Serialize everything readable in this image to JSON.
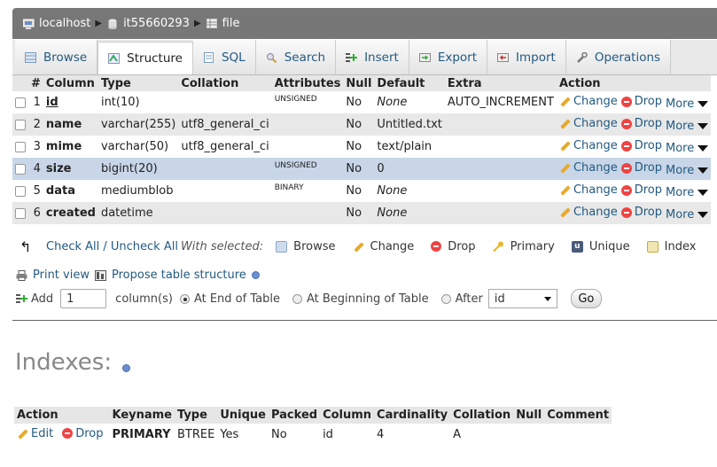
{
  "breadcrumb": {
    "server": "localhost",
    "database": "it55660293",
    "table": "file"
  },
  "tabs": [
    {
      "label": "Browse",
      "icon": "table-icon"
    },
    {
      "label": "Structure",
      "icon": "structure-icon",
      "active": true
    },
    {
      "label": "SQL",
      "icon": "sql-icon"
    },
    {
      "label": "Search",
      "icon": "search-icon"
    },
    {
      "label": "Insert",
      "icon": "insert-icon"
    },
    {
      "label": "Export",
      "icon": "export-icon"
    },
    {
      "label": "Import",
      "icon": "import-icon"
    },
    {
      "label": "Operations",
      "icon": "wrench-icon"
    }
  ],
  "structure": {
    "headers": {
      "num": "#",
      "column": "Column",
      "type": "Type",
      "collation": "Collation",
      "attributes": "Attributes",
      "null": "Null",
      "default": "Default",
      "extra": "Extra",
      "action": "Action"
    },
    "rows": [
      {
        "num": "1",
        "column": "id",
        "type": "int(10)",
        "collation": "",
        "attributes": "UNSIGNED",
        "null": "No",
        "default": "None",
        "extra": "AUTO_INCREMENT"
      },
      {
        "num": "2",
        "column": "name",
        "type": "varchar(255)",
        "collation": "utf8_general_ci",
        "attributes": "",
        "null": "No",
        "default": "Untitled.txt",
        "extra": ""
      },
      {
        "num": "3",
        "column": "mime",
        "type": "varchar(50)",
        "collation": "utf8_general_ci",
        "attributes": "",
        "null": "No",
        "default": "text/plain",
        "extra": ""
      },
      {
        "num": "4",
        "column": "size",
        "type": "bigint(20)",
        "collation": "",
        "attributes": "UNSIGNED",
        "null": "No",
        "default": "0",
        "extra": ""
      },
      {
        "num": "5",
        "column": "data",
        "type": "mediumblob",
        "collation": "",
        "attributes": "BINARY",
        "null": "No",
        "default": "None",
        "extra": ""
      },
      {
        "num": "6",
        "column": "created",
        "type": "datetime",
        "collation": "",
        "attributes": "",
        "null": "No",
        "default": "None",
        "extra": ""
      }
    ],
    "actions": {
      "change": "Change",
      "drop": "Drop",
      "more": "More"
    }
  },
  "with_selected": {
    "check_all": "Check All / Uncheck All",
    "with_selected": "With selected:",
    "buttons": [
      "Browse",
      "Change",
      "Drop",
      "Primary",
      "Unique",
      "Index"
    ]
  },
  "tools": {
    "print_view": "Print view",
    "propose": "Propose table structure"
  },
  "add_columns": {
    "add": "Add",
    "count": "1",
    "columns_label": "column(s)",
    "at_end": "At End of Table",
    "at_beginning": "At Beginning of Table",
    "after": "After",
    "after_value": "id",
    "go": "Go"
  },
  "indexes": {
    "title": "Indexes:",
    "headers": [
      "Action",
      "Keyname",
      "Type",
      "Unique",
      "Packed",
      "Column",
      "Cardinality",
      "Collation",
      "Null",
      "Comment"
    ],
    "rows": [
      {
        "edit": "Edit",
        "drop": "Drop",
        "keyname": "PRIMARY",
        "type": "BTREE",
        "unique": "Yes",
        "packed": "No",
        "column": "id",
        "cardinality": "4",
        "collation": "A",
        "null": "",
        "comment": ""
      }
    ]
  },
  "colors": {
    "link": "#235a81",
    "header_bar": "#777777",
    "highlight_row": "#c8d6e8"
  }
}
